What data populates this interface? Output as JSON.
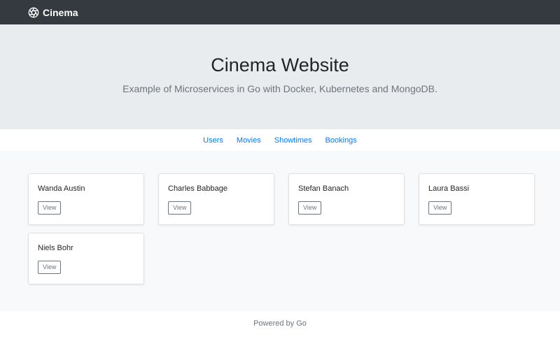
{
  "navbar": {
    "brand_label": "Cinema",
    "brand_icon": "aperture-icon"
  },
  "hero": {
    "title": "Cinema Website",
    "subtitle": "Example of Microservices in Go with Docker, Kubernetes and MongoDB."
  },
  "subnav": {
    "items": [
      {
        "label": "Users"
      },
      {
        "label": "Movies"
      },
      {
        "label": "Showtimes"
      },
      {
        "label": "Bookings"
      }
    ]
  },
  "users": [
    {
      "name": "Wanda Austin",
      "button_label": "View"
    },
    {
      "name": "Charles Babbage",
      "button_label": "View"
    },
    {
      "name": "Stefan Banach",
      "button_label": "View"
    },
    {
      "name": "Laura Bassi",
      "button_label": "View"
    },
    {
      "name": "Niels Bohr",
      "button_label": "View"
    }
  ],
  "footer": {
    "text": "Powered by Go"
  },
  "colors": {
    "navbar_bg": "#343a40",
    "hero_bg": "#e9ecef",
    "content_bg": "#f8f9fa",
    "link": "#007bff",
    "muted": "#6c757d"
  }
}
